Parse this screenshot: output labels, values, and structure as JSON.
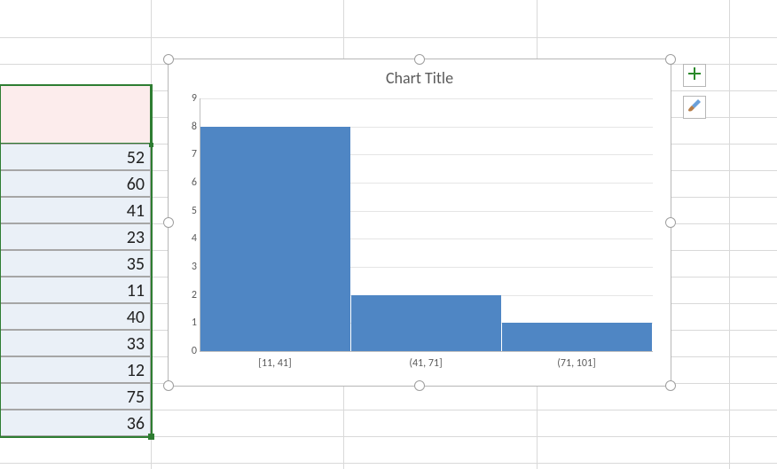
{
  "sheet": {
    "values": [
      "52",
      "60",
      "41",
      "23",
      "35",
      "11",
      "40",
      "33",
      "12",
      "75",
      "36"
    ]
  },
  "chart": {
    "title": "Chart Title",
    "y_ticks": [
      "0",
      "1",
      "2",
      "3",
      "4",
      "5",
      "6",
      "7",
      "8",
      "9"
    ],
    "x_labels": [
      "[11, 41]",
      "(41, 71]",
      "(71, 101]"
    ]
  },
  "chart_data": {
    "type": "bar",
    "subtype": "histogram",
    "title": "Chart Title",
    "xlabel": "",
    "ylabel": "",
    "ylim": [
      0,
      9
    ],
    "categories": [
      "[11, 41]",
      "(41, 71]",
      "(71, 101]"
    ],
    "values": [
      8,
      2,
      1
    ]
  }
}
